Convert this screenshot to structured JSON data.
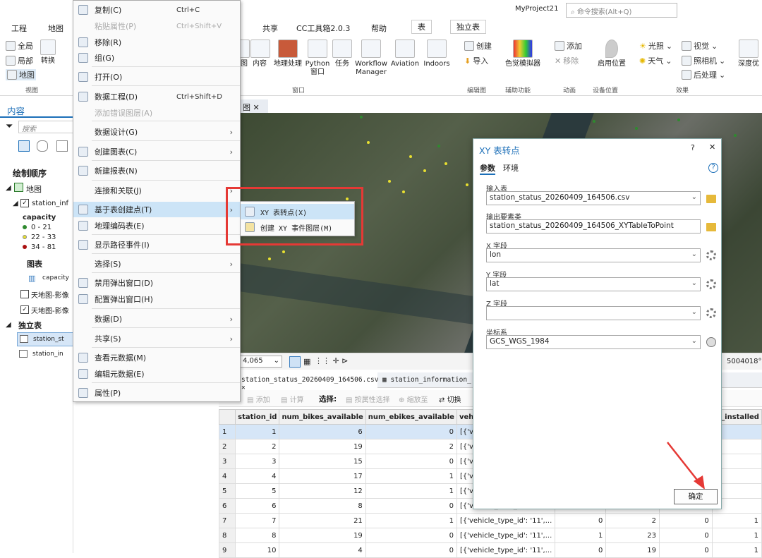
{
  "titlebar": {
    "project": "MyProject21",
    "search_placeholder": "命令搜索(Alt+Q)"
  },
  "ribbon": {
    "tabs": [
      {
        "label": "工程"
      },
      {
        "label": "地图"
      },
      {
        "label": "共享"
      },
      {
        "label": "CC工具箱2.0.3"
      },
      {
        "label": "帮助"
      },
      {
        "label": "表"
      },
      {
        "label": "独立表"
      }
    ],
    "left": {
      "full": "全局",
      "local": "局部",
      "map": "地图",
      "convert": "转换",
      "view_group": "视图"
    },
    "buttons": [
      {
        "label": "图"
      },
      {
        "label": "内容"
      },
      {
        "label": "地理处理"
      },
      {
        "label": "Python 窗口"
      },
      {
        "label": "任务"
      },
      {
        "label": "Workflow Manager"
      },
      {
        "label": "Aviation"
      },
      {
        "label": "Indoors"
      }
    ],
    "window_group": "窗口",
    "create": "创建",
    "import": "导入",
    "catalog_group": "编辑图",
    "simulator": "色觉模拟器",
    "assist_group": "辅助功能",
    "add": "添加",
    "remove": "移除",
    "anim_group": "动画",
    "location": "启用位置",
    "device_group": "设备位置",
    "effects": {
      "light": "光照",
      "view": "视觉",
      "weather": "天气",
      "camera": "照相机",
      "post": "后处理",
      "depth": "深度优",
      "group": "效果"
    }
  },
  "leftpane": {
    "title": "内容",
    "search": "搜索",
    "draw_order": "绘制顺序",
    "map_item": "地图",
    "layer1": "station_inf",
    "capacity_label": "capacity",
    "ranges": [
      "0 - 21",
      "22 - 33",
      "34 - 81"
    ],
    "chart_label": "图表",
    "chart_item": "capacity",
    "base1": "天地图-影像",
    "base2": "天地图-影像",
    "tables_label": "独立表",
    "table1": "station_st",
    "table2": "station_in"
  },
  "menu": [
    {
      "label": "复制(C)",
      "key": "Ctrl+C",
      "disabled": false
    },
    {
      "label": "粘贴属性(P)",
      "key": "Ctrl+Shift+V",
      "disabled": true
    },
    {
      "label": "移除(R)",
      "key": "",
      "disabled": false
    },
    {
      "label": "组(G)",
      "key": "",
      "disabled": false
    },
    {
      "label": "打开(O)",
      "key": "",
      "disabled": false
    },
    {
      "label": "数据工程(D)",
      "key": "Ctrl+Shift+D",
      "disabled": false
    },
    {
      "label": "添加错误图层(A)",
      "key": "",
      "disabled": true
    },
    {
      "label": "数据设计(G)",
      "key": "",
      "disabled": false
    },
    {
      "label": "创建图表(C)",
      "key": "",
      "disabled": false
    },
    {
      "label": "新建报表(N)",
      "key": "",
      "disabled": false
    },
    {
      "label": "连接和关联(J)",
      "key": "",
      "disabled": false
    },
    {
      "label": "基于表创建点(T)",
      "key": "",
      "disabled": false
    },
    {
      "label": "地理编码表(E)",
      "key": "",
      "disabled": false
    },
    {
      "label": "显示路径事件(I)",
      "key": "",
      "disabled": false
    },
    {
      "label": "选择(S)",
      "key": "",
      "disabled": false
    },
    {
      "label": "禁用弹出窗口(D)",
      "key": "",
      "disabled": false
    },
    {
      "label": "配置弹出窗口(H)",
      "key": "",
      "disabled": false
    },
    {
      "label": "数据(D)",
      "key": "",
      "disabled": false
    },
    {
      "label": "共享(S)",
      "key": "",
      "disabled": false
    },
    {
      "label": "查看元数据(M)",
      "key": "",
      "disabled": false
    },
    {
      "label": "编辑元数据(E)",
      "key": "",
      "disabled": false
    },
    {
      "label": "属性(P)",
      "key": "",
      "disabled": false
    }
  ],
  "submenu": [
    {
      "label": "XY 表转点(X)"
    },
    {
      "label": "创建 XY 事件图层(M)"
    }
  ],
  "map_tab": "图",
  "status": {
    "scale": "4,065",
    "coords": "5004018°"
  },
  "tbl_tabs": [
    "station_status_20260409_164506.csv",
    "station_information_"
  ],
  "tbl_tool": {
    "add": "添加",
    "calc": "计算",
    "select": "选择:",
    "by_attr": "按属性选择",
    "zoom": "缩放至",
    "switch": "切换"
  },
  "table": {
    "headers": [
      "",
      "station_id",
      "num_bikes_available",
      "num_ebikes_available",
      "vehicle_types_a",
      "",
      "",
      "",
      "is_installed"
    ],
    "rows": [
      [
        "1",
        "1",
        "6",
        "0",
        "[{'vehicle_type_",
        "",
        "",
        "",
        ""
      ],
      [
        "2",
        "2",
        "19",
        "2",
        "[{'vehicle_type_",
        "",
        "",
        "",
        ""
      ],
      [
        "3",
        "3",
        "15",
        "0",
        "[{'vehicle_type_",
        "",
        "",
        "",
        ""
      ],
      [
        "4",
        "4",
        "17",
        "1",
        "[{'vehicle_type_",
        "",
        "",
        "",
        ""
      ],
      [
        "5",
        "5",
        "12",
        "1",
        "[{'vehicle_type_",
        "",
        "",
        "",
        ""
      ],
      [
        "6",
        "6",
        "8",
        "0",
        "[{'vehicle_type_",
        "",
        "",
        "",
        ""
      ],
      [
        "7",
        "7",
        "21",
        "1",
        "[{'vehicle_type_id': '11',...",
        "0",
        "2",
        "0",
        "1"
      ],
      [
        "8",
        "8",
        "19",
        "0",
        "[{'vehicle_type_id': '11',...",
        "1",
        "23",
        "0",
        "1"
      ],
      [
        "9",
        "10",
        "4",
        "0",
        "[{'vehicle_type_id': '11',...",
        "0",
        "19",
        "0",
        "1"
      ]
    ]
  },
  "dialog": {
    "title": "XY 表转点",
    "tab_params": "参数",
    "tab_env": "环境",
    "input_label": "输入表",
    "input_value": "station_status_20260409_164506.csv",
    "output_label": "输出要素类",
    "output_value": "station_status_20260409_164506_XYTableToPoint",
    "x_label": "X 字段",
    "x_value": "lon",
    "y_label": "Y 字段",
    "y_value": "lat",
    "z_label": "Z 字段",
    "z_value": "",
    "crs_label": "坐标系",
    "crs_value": "GCS_WGS_1984",
    "ok": "确定"
  }
}
